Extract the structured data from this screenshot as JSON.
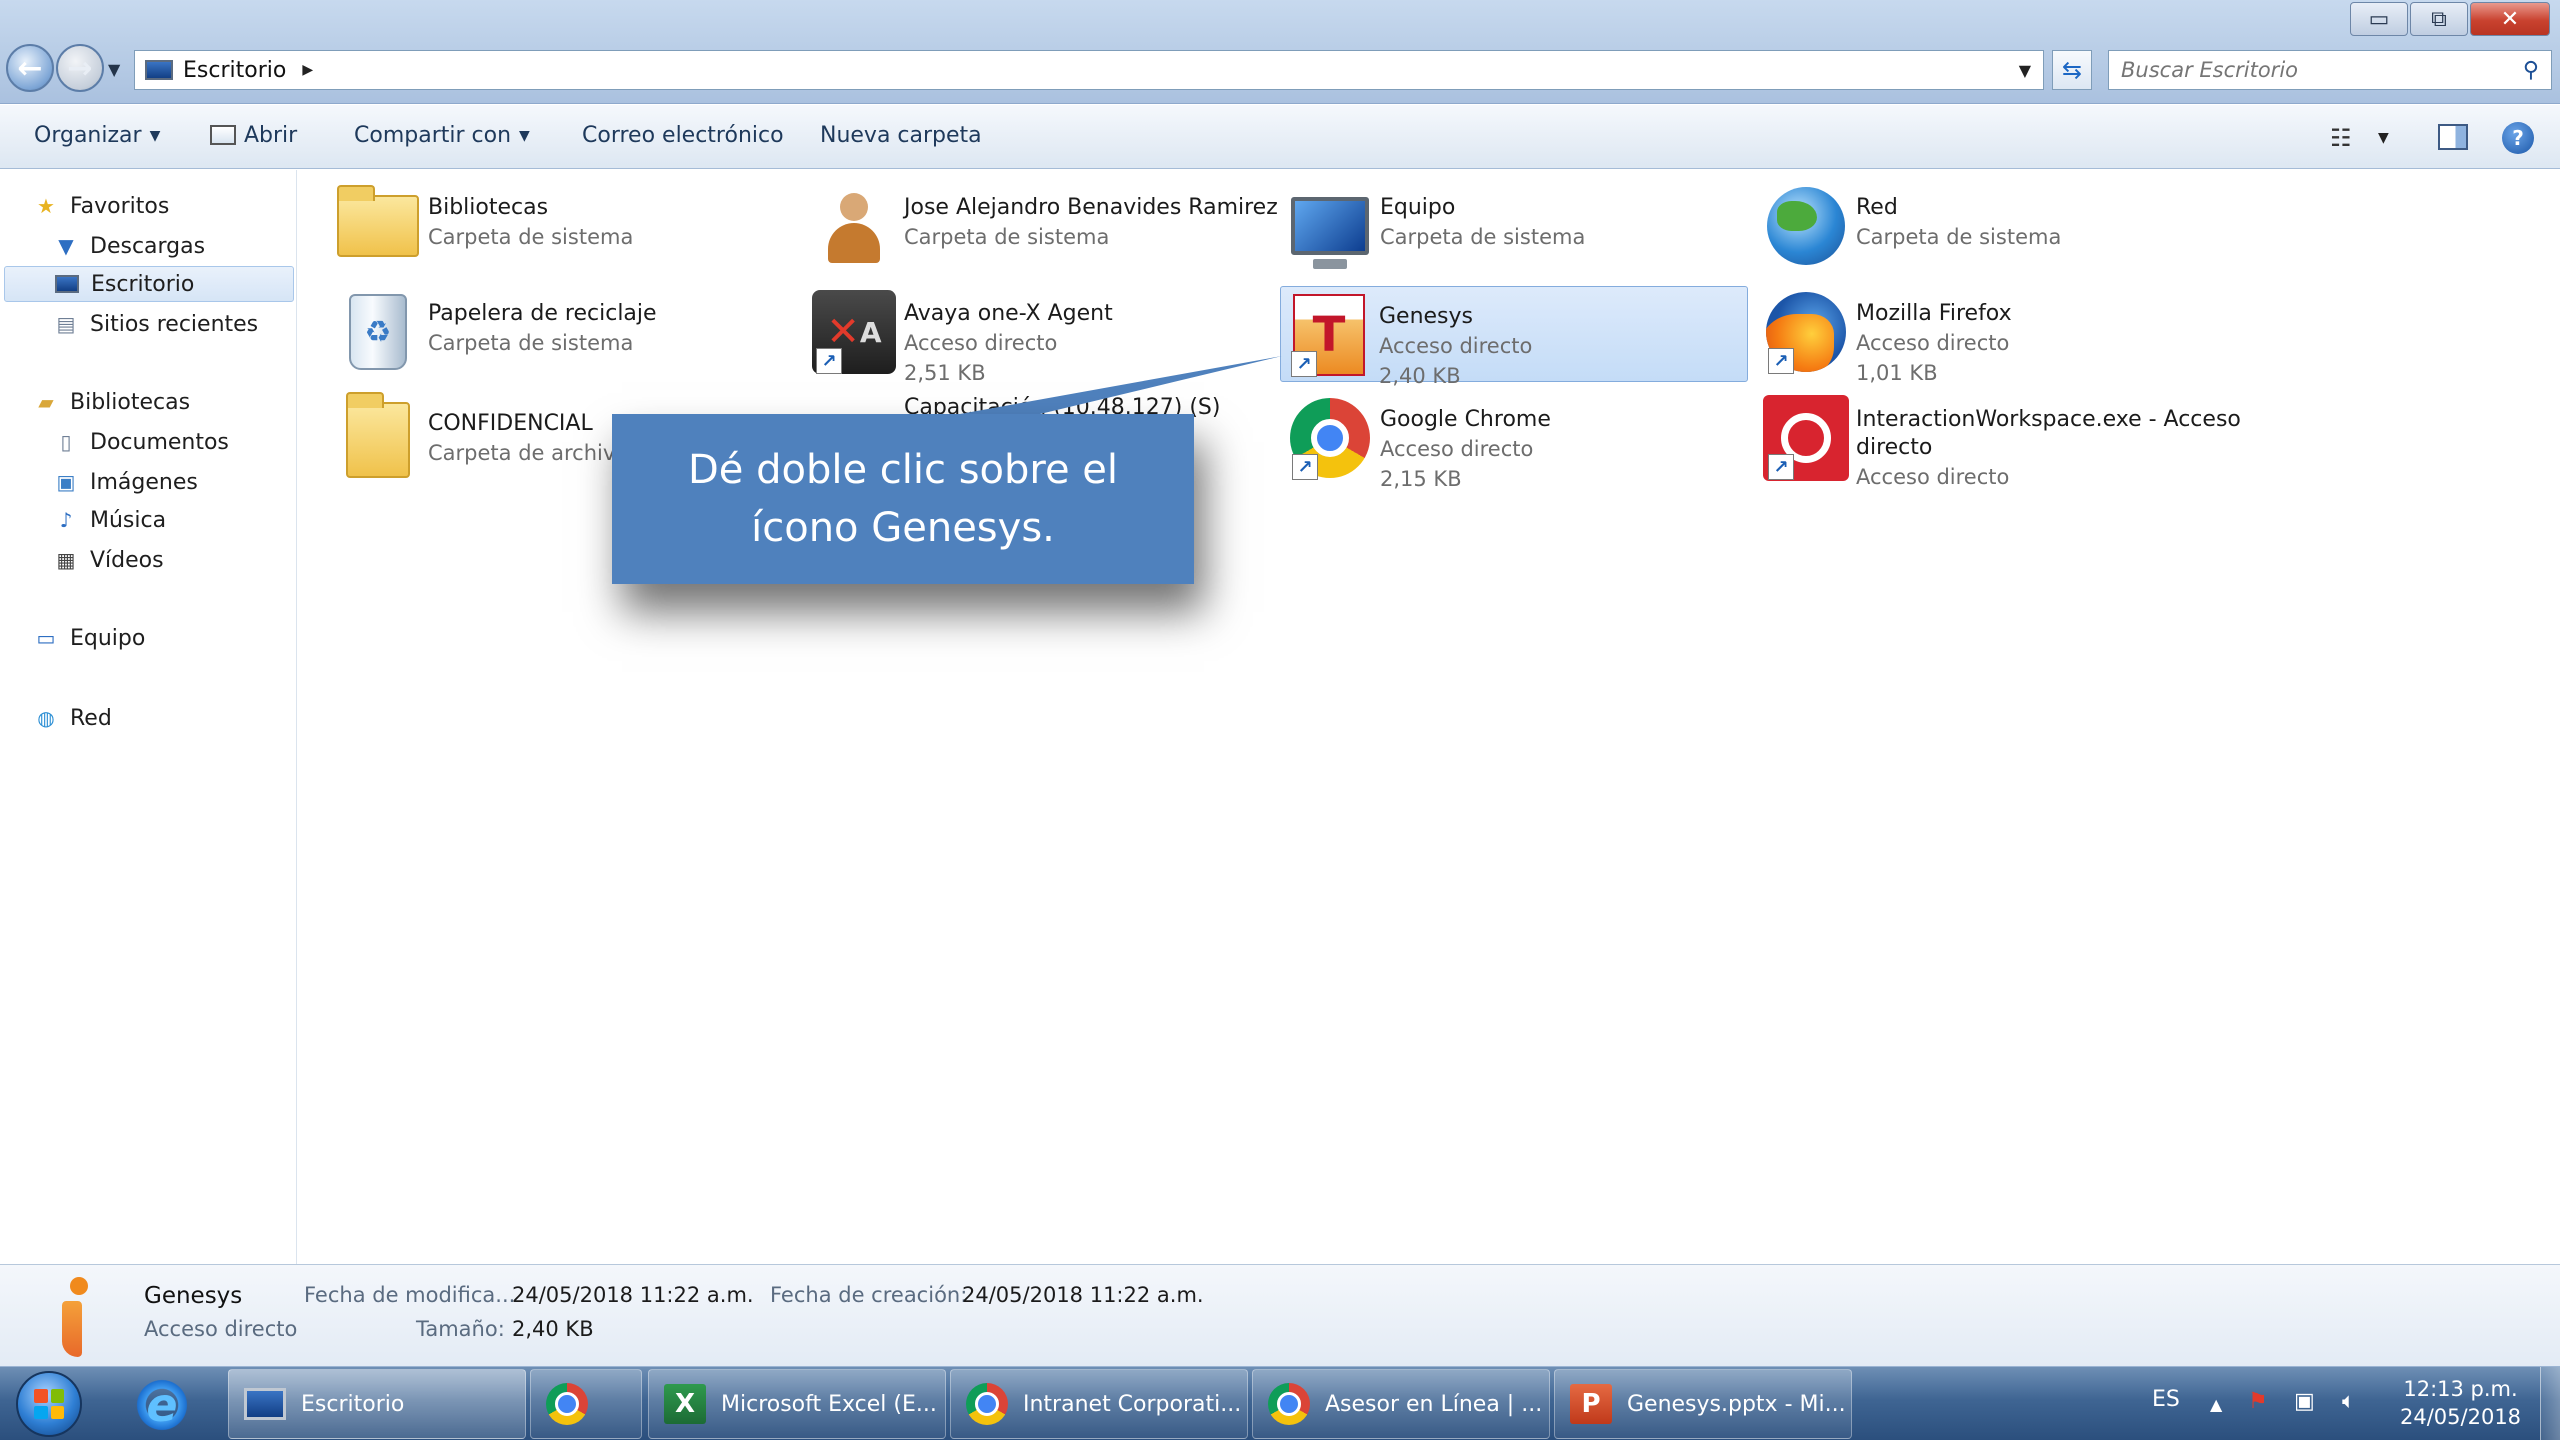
{
  "window": {
    "controls": {
      "minimize": "▭",
      "maximize": "⧉",
      "close": "✕"
    }
  },
  "address_bar": {
    "path": "Escritorio",
    "search_placeholder": "Buscar Escritorio"
  },
  "command_bar": {
    "organize": "Organizar",
    "open": "Abrir",
    "share": "Compartir con",
    "email": "Correo electrónico",
    "new_folder": "Nueva carpeta"
  },
  "nav_pane": {
    "favorites": "Favoritos",
    "downloads": "Descargas",
    "desktop": "Escritorio",
    "recent": "Sitios recientes",
    "libraries": "Bibliotecas",
    "documents": "Documentos",
    "pictures": "Imágenes",
    "music": "Música",
    "videos": "Vídeos",
    "computer": "Equipo",
    "network": "Red"
  },
  "items": {
    "bibliotecas": {
      "name": "Bibliotecas",
      "sub": "Carpeta de sistema"
    },
    "user": {
      "name": "Jose Alejandro Benavides Ramirez",
      "sub": "Carpeta de sistema"
    },
    "equipo": {
      "name": "Equipo",
      "sub": "Carpeta de sistema"
    },
    "red": {
      "name": "Red",
      "sub": "Carpeta de sistema"
    },
    "papelera": {
      "name": "Papelera de reciclaje",
      "sub": "Carpeta de sistema"
    },
    "avaya": {
      "name": "Avaya one-X Agent",
      "sub": "Acceso directo",
      "size": "2,51 KB"
    },
    "genesys": {
      "name": "Genesys",
      "sub": "Acceso directo",
      "size": "2,40 KB"
    },
    "firefox": {
      "name": "Mozilla Firefox",
      "sub": "Acceso directo",
      "size": "1,01 KB"
    },
    "confidencial": {
      "name": "CONFIDENCIAL",
      "sub": "Carpeta de archivos"
    },
    "capacitacion": {
      "name": "Capacitación (10.48.127) (S)"
    },
    "chrome": {
      "name": "Google Chrome",
      "sub": "Acceso directo",
      "size": "2,15 KB"
    },
    "interaction": {
      "name": "InteractionWorkspace.exe - Acceso",
      "name2": "directo",
      "sub": "Acceso directo"
    }
  },
  "callout": {
    "text": "Dé doble clic sobre el ícono Genesys."
  },
  "details": {
    "name": "Genesys",
    "type": "Acceso directo",
    "modified_label": "Fecha de modifica...",
    "modified_value": "24/05/2018 11:22 a.m.",
    "created_label": "Fecha de creación:",
    "created_value": "24/05/2018 11:22 a.m.",
    "size_label": "Tamaño:",
    "size_value": "2,40 KB"
  },
  "taskbar": {
    "explorer": "Escritorio",
    "excel": "Microsoft Excel (E...",
    "intranet": "Intranet Corporati...",
    "asesor": "Asesor en Línea | ...",
    "ppt": "Genesys.pptx - Mi...",
    "lang": "ES",
    "time": "12:13 p.m.",
    "date": "24/05/2018"
  },
  "colors": {
    "callout_bg": "#4f81bd",
    "selection": "#c4dcf7",
    "taskbar": "#3f6593"
  }
}
